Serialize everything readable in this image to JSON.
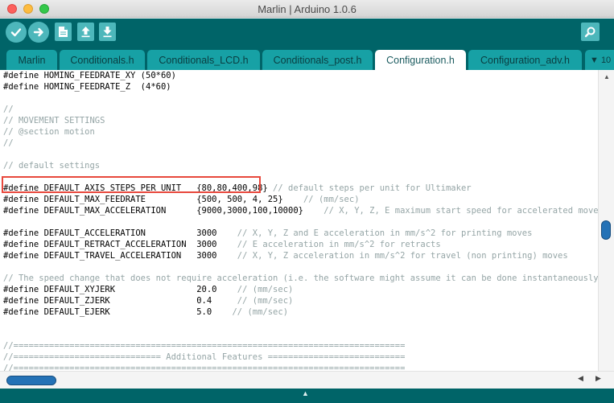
{
  "window": {
    "title": "Marlin | Arduino 1.0.6"
  },
  "toolbar": {
    "verify_icon": "check-icon",
    "upload_icon": "arrow-right-icon",
    "new_icon": "new-file-icon",
    "open_icon": "open-up-icon",
    "save_icon": "save-down-icon",
    "serial_icon": "magnifier-icon"
  },
  "tabs": [
    {
      "label": "Marlin"
    },
    {
      "label": "Conditionals.h"
    },
    {
      "label": "Conditionals_LCD.h"
    },
    {
      "label": "Conditionals_post.h"
    },
    {
      "label": "Configuration.h",
      "active": true
    },
    {
      "label": "Configuration_adv.h"
    }
  ],
  "tab_menu": {
    "label": "▼ 10"
  },
  "editor": {
    "lines": [
      {
        "code": "#define HOMING_FEEDRATE_XY (50*60)",
        "comment": ""
      },
      {
        "code": "#define HOMING_FEEDRATE_Z  (4*60)",
        "comment": ""
      },
      {
        "code": "",
        "comment": ""
      },
      {
        "code": "",
        "comment": "//"
      },
      {
        "code": "",
        "comment": "// MOVEMENT SETTINGS"
      },
      {
        "code": "",
        "comment": "// @section motion"
      },
      {
        "code": "",
        "comment": "//"
      },
      {
        "code": "",
        "comment": ""
      },
      {
        "code": "",
        "comment": "// default settings"
      },
      {
        "code": "",
        "comment": ""
      },
      {
        "code": "#define DEFAULT_AXIS_STEPS_PER_UNIT   {80,80,400,98} ",
        "comment": "// default steps per unit for Ultimaker"
      },
      {
        "code": "#define DEFAULT_MAX_FEEDRATE          {500, 500, 4, 25}    ",
        "comment": "// (mm/sec)"
      },
      {
        "code": "#define DEFAULT_MAX_ACCELERATION      {9000,3000,100,10000}    ",
        "comment": "// X, Y, Z, E maximum start speed for accelerated moves. E de"
      },
      {
        "code": "",
        "comment": ""
      },
      {
        "code": "#define DEFAULT_ACCELERATION          3000    ",
        "comment": "// X, Y, Z and E acceleration in mm/s^2 for printing moves"
      },
      {
        "code": "#define DEFAULT_RETRACT_ACCELERATION  3000    ",
        "comment": "// E acceleration in mm/s^2 for retracts"
      },
      {
        "code": "#define DEFAULT_TRAVEL_ACCELERATION   3000    ",
        "comment": "// X, Y, Z acceleration in mm/s^2 for travel (non printing) moves"
      },
      {
        "code": "",
        "comment": ""
      },
      {
        "code": "",
        "comment": "// The speed change that does not require acceleration (i.e. the software might assume it can be done instantaneously)"
      },
      {
        "code": "#define DEFAULT_XYJERK                20.0    ",
        "comment": "// (mm/sec)"
      },
      {
        "code": "#define DEFAULT_ZJERK                 0.4     ",
        "comment": "// (mm/sec)"
      },
      {
        "code": "#define DEFAULT_EJERK                 5.0    ",
        "comment": "// (mm/sec)"
      },
      {
        "code": "",
        "comment": ""
      },
      {
        "code": "",
        "comment": ""
      },
      {
        "code": "",
        "comment": "//============================================================================="
      },
      {
        "code": "",
        "comment": "//============================= Additional Features ==========================="
      },
      {
        "code": "",
        "comment": "//============================================================================="
      }
    ]
  },
  "scrollbars": {
    "vertical_up_icon": "chevron-up-icon",
    "horizontal_left_icon": "chevron-left-icon",
    "horizontal_right_icon": "chevron-right-icon"
  },
  "colors": {
    "toolbar": "#006468",
    "tab_inactive": "#17a1a5",
    "tab_active": "#ffffff",
    "comment": "#95a5a6",
    "highlight_box": "#e8483c",
    "scroll_thumb": "#2472b6"
  }
}
